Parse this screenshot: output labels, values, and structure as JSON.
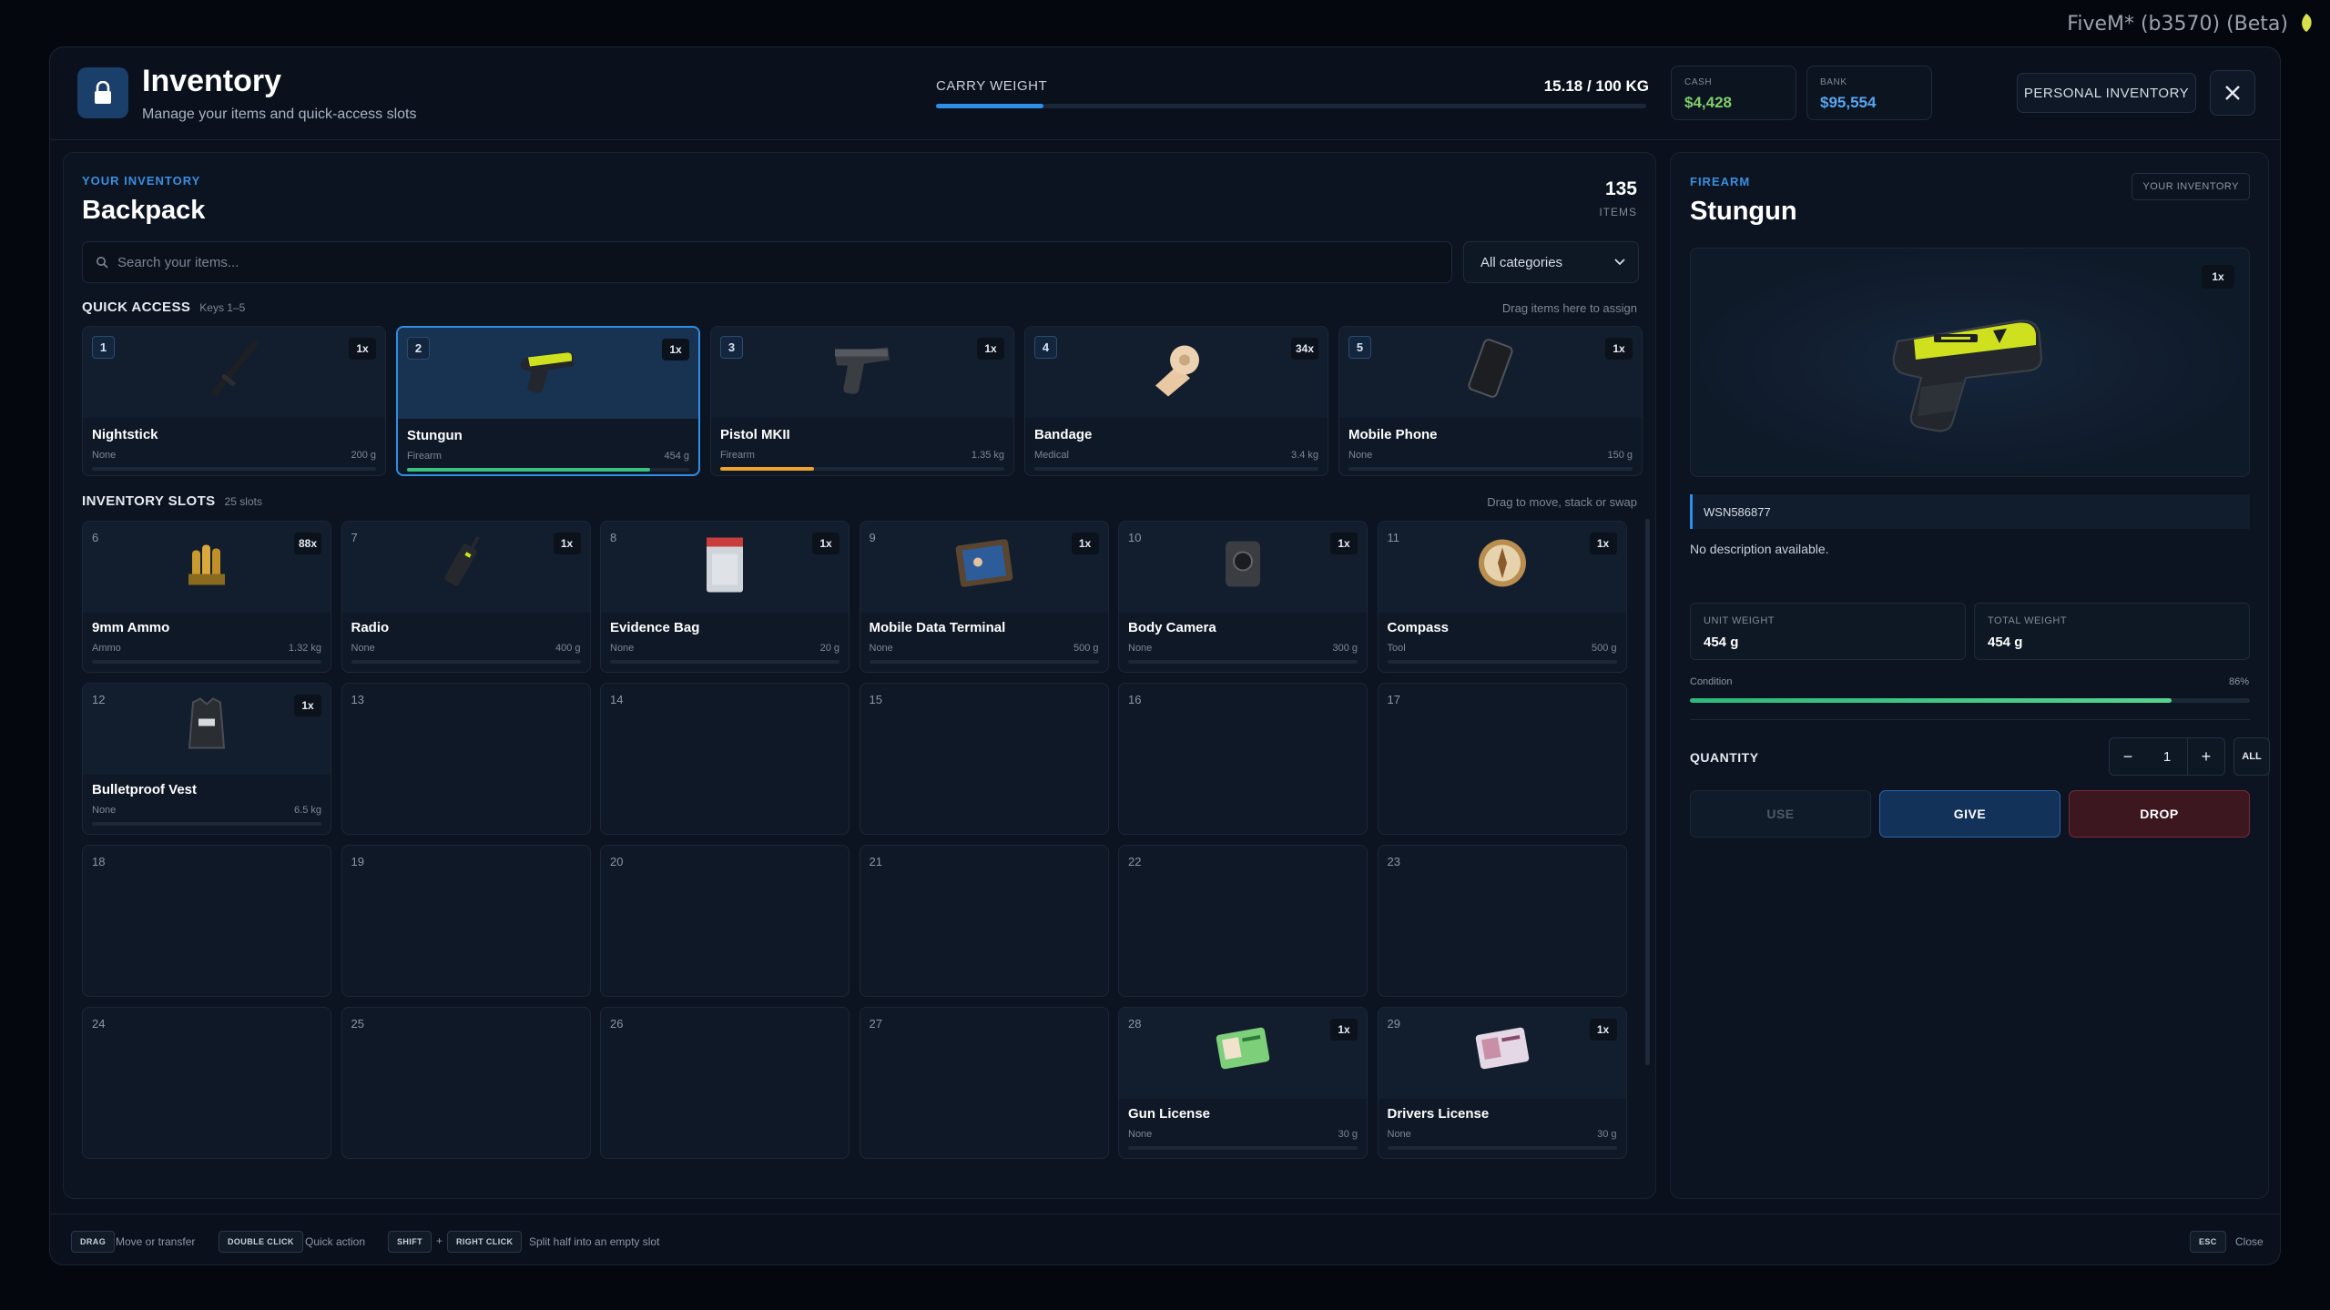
{
  "system": {
    "fivem_label": "FiveM* (b3570) (Beta)"
  },
  "header": {
    "title": "Inventory",
    "subtitle": "Manage your items and quick-access slots",
    "carry_label": "CARRY WEIGHT",
    "carry_value": "15.18 / 100 KG",
    "carry_fraction": 0.1518,
    "cash_label": "CASH",
    "cash_value": "$4,428",
    "bank_label": "BANK",
    "bank_value": "$95,554",
    "personal_btn": "PERSONAL INVENTORY"
  },
  "left": {
    "section_label": "YOUR INVENTORY",
    "title": "Backpack",
    "item_count": "135",
    "item_count_label": "ITEMS",
    "search_placeholder": "Search your items...",
    "category_select": "All categories",
    "quick_access": {
      "title": "QUICK ACCESS",
      "sub": "Keys 1–5",
      "hint": "Drag items here to assign",
      "slots": [
        {
          "num": "1",
          "qty": "1x",
          "name": "Nightstick",
          "cat": "None",
          "weight": "200 g",
          "icon": "nightstick-icon"
        },
        {
          "num": "2",
          "qty": "1x",
          "name": "Stungun",
          "cat": "Firearm",
          "weight": "454 g",
          "icon": "stungun-icon",
          "durability": 0.86
        },
        {
          "num": "3",
          "qty": "1x",
          "name": "Pistol MKII",
          "cat": "Firearm",
          "weight": "1.35 kg",
          "icon": "pistol-icon",
          "durability": 0.33
        },
        {
          "num": "4",
          "qty": "34x",
          "name": "Bandage",
          "cat": "Medical",
          "weight": "3.4 kg",
          "icon": "bandage-icon"
        },
        {
          "num": "5",
          "qty": "1x",
          "name": "Mobile Phone",
          "cat": "None",
          "weight": "150 g",
          "icon": "phone-icon"
        }
      ]
    },
    "slots_section": {
      "title": "INVENTORY SLOTS",
      "sub": "25 slots",
      "hint": "Drag to move, stack or swap",
      "slots": [
        {
          "num": "6",
          "qty": "88x",
          "name": "9mm Ammo",
          "cat": "Ammo",
          "weight": "1.32 kg",
          "icon": "ammo-icon"
        },
        {
          "num": "7",
          "qty": "1x",
          "name": "Radio",
          "cat": "None",
          "weight": "400 g",
          "icon": "radio-icon"
        },
        {
          "num": "8",
          "qty": "1x",
          "name": "Evidence Bag",
          "cat": "None",
          "weight": "20 g",
          "icon": "evidence-bag-icon"
        },
        {
          "num": "9",
          "qty": "1x",
          "name": "Mobile Data Terminal",
          "cat": "None",
          "weight": "500 g",
          "icon": "tablet-icon"
        },
        {
          "num": "10",
          "qty": "1x",
          "name": "Body Camera",
          "cat": "None",
          "weight": "300 g",
          "icon": "camera-icon"
        },
        {
          "num": "11",
          "qty": "1x",
          "name": "Compass",
          "cat": "Tool",
          "weight": "500 g",
          "icon": "compass-icon"
        },
        {
          "num": "12",
          "qty": "1x",
          "name": "Bulletproof Vest",
          "cat": "None",
          "weight": "6.5 kg",
          "icon": "vest-icon"
        },
        {
          "num": "13"
        },
        {
          "num": "14"
        },
        {
          "num": "15"
        },
        {
          "num": "16"
        },
        {
          "num": "17"
        },
        {
          "num": "18"
        },
        {
          "num": "19"
        },
        {
          "num": "20"
        },
        {
          "num": "21"
        },
        {
          "num": "22"
        },
        {
          "num": "23"
        },
        {
          "num": "24"
        },
        {
          "num": "25"
        },
        {
          "num": "26"
        },
        {
          "num": "27"
        },
        {
          "num": "28",
          "qty": "1x",
          "name": "Gun License",
          "cat": "None",
          "weight": "30 g",
          "icon": "gun-license-icon"
        },
        {
          "num": "29",
          "qty": "1x",
          "name": "Drivers License",
          "cat": "None",
          "weight": "30 g",
          "icon": "drivers-license-icon"
        }
      ]
    }
  },
  "detail": {
    "category": "FIREARM",
    "title": "Stungun",
    "source_btn": "YOUR INVENTORY",
    "qty": "1x",
    "serial": "WSN586877",
    "description": "No description available.",
    "unit_weight_label": "UNIT WEIGHT",
    "unit_weight": "454 g",
    "total_weight_label": "TOTAL WEIGHT",
    "total_weight": "454 g",
    "condition_label": "Condition",
    "condition_pct": "86%",
    "condition_value": 0.86,
    "quantity_label": "QUANTITY",
    "quantity_value": "1",
    "minus": "−",
    "plus": "+",
    "all": "ALL",
    "use_btn": "USE",
    "give_btn": "GIVE",
    "drop_btn": "DROP"
  },
  "footer": {
    "drag_key": "DRAG",
    "drag_txt": "Move or transfer",
    "dbl_key": "DOUBLE CLICK",
    "dbl_txt": "Quick action",
    "shift_key": "SHIFT",
    "plus": "+",
    "right_key": "RIGHT CLICK",
    "split_txt": "Split half into an empty slot",
    "esc_key": "ESC",
    "close_txt": "Close"
  },
  "colors": {
    "accent": "#2e8ee8",
    "cash": "#7fcf6b",
    "bank": "#58a6f0",
    "drop": "#4a1a22",
    "give": "#12325a"
  }
}
